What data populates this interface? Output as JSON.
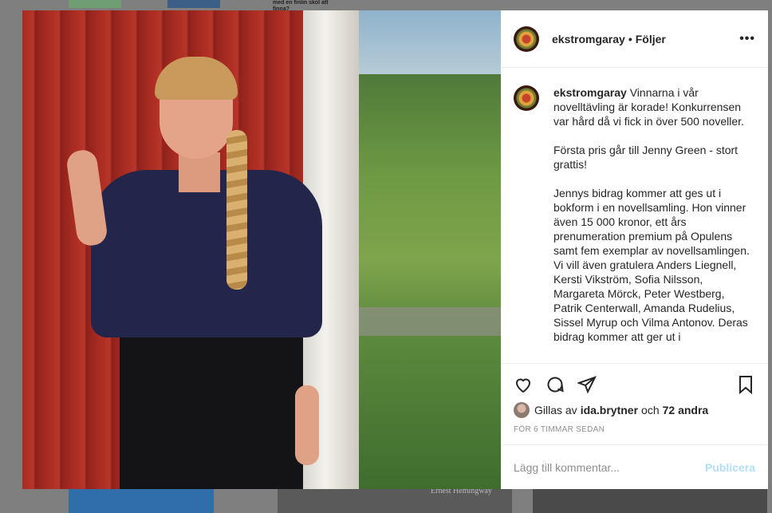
{
  "background": {
    "top_text": "med en finlin skol att finna?",
    "caption": "Ernest Hemingway"
  },
  "post": {
    "username": "ekstromgaray",
    "follow_separator": "•",
    "follow_label": "Följer",
    "more_label": "•••"
  },
  "caption": {
    "username": "ekstromgaray",
    "text": " Vinnarna i vår novelltävling är korade! Konkurrensen var hård då vi fick in över 500 noveller.\n\nFörsta pris går till Jenny Green - stort grattis!\n\nJennys bidrag kommer att ges ut i bokform i en novellsamling. Hon vinner även 15 000 kronor, ett års prenumeration premium på Opulens samt fem exemplar av novellsamlingen. Vi vill även gratulera Anders Liegnell, Kersti Vikström, Sofia Nilsson, Margareta Mörck, Peter Westberg, Patrik Centerwall, Amanda Rudelius, Sissel Myrup och Vilma Antonov. Deras bidrag kommer att ger ut i"
  },
  "likes": {
    "prefix": "Gillas av",
    "user": "ida.brytner",
    "conjunction": "och",
    "others": "72 andra"
  },
  "timestamp": "FÖR 6 TIMMAR SEDAN",
  "comment": {
    "placeholder": "Lägg till kommentar...",
    "publish_label": "Publicera"
  },
  "colors": {
    "publish_disabled": "#b2dffc",
    "muted": "#8e8e8e"
  }
}
